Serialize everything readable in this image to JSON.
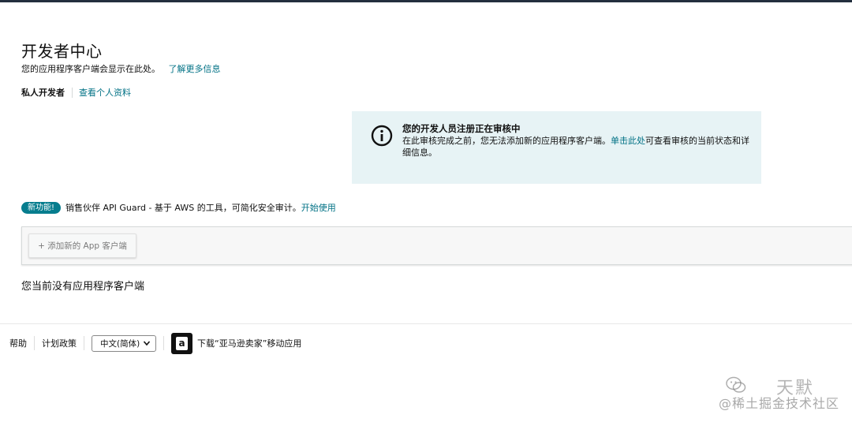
{
  "header": {
    "title": "开发者中心",
    "subtitle": "您的应用程序客户端会显示在此处。",
    "learn_more": "了解更多信息"
  },
  "account": {
    "type": "私人开发者",
    "view_profile": "查看个人资料"
  },
  "alert": {
    "icon": "info-circle-icon",
    "heading": "您的开发人员注册正在审核中",
    "body_prefix": "在此审核完成之前，您无法添加新的应用程序客户端。",
    "click_here": "单击此处",
    "body_suffix": "可查看审核的当前状态和详细信息。"
  },
  "new_feature": {
    "badge": "新功能!",
    "text": "销售伙伴 API Guard - 基于 AWS 的工具，可简化安全审计。",
    "get_started": "开始使用"
  },
  "clients": {
    "add_button": "+ 添加新的 App 客户端",
    "empty_message": "您当前没有应用程序客户端"
  },
  "footer": {
    "help": "帮助",
    "policies": "计划政策",
    "language": "中文(简体)",
    "app_icon": "amazon-seller-app-icon",
    "download": "下载“亚马逊卖家”移动应用"
  },
  "watermark": {
    "line1": "天默",
    "line2": "@稀土掘金技术社区"
  },
  "colors": {
    "link": "#007185",
    "badge": "#067d8e",
    "alert_bg": "#e7f3f5",
    "top_border": "#232f3e"
  }
}
